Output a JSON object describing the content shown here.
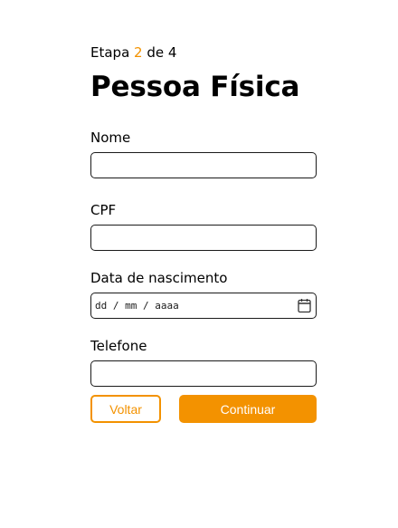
{
  "progress": {
    "prefix": "Etapa",
    "current": "2",
    "middle": "de",
    "total": "4"
  },
  "title": "Pessoa Física",
  "fields": [
    {
      "label": "Nome",
      "value": ""
    },
    {
      "label": "CPF",
      "value": ""
    },
    {
      "label": "Data de nascimento",
      "value": "",
      "placeholder": "dd / mm / aaaa"
    },
    {
      "label": "Telefone",
      "value": ""
    }
  ],
  "buttons": {
    "back_label": "Voltar",
    "next_label": "Continuar"
  },
  "colors": {
    "accent": "#f39200",
    "text": "#000000",
    "border": "#1a1a1a"
  },
  "icons": {
    "date_picker": "calendar-icon"
  }
}
